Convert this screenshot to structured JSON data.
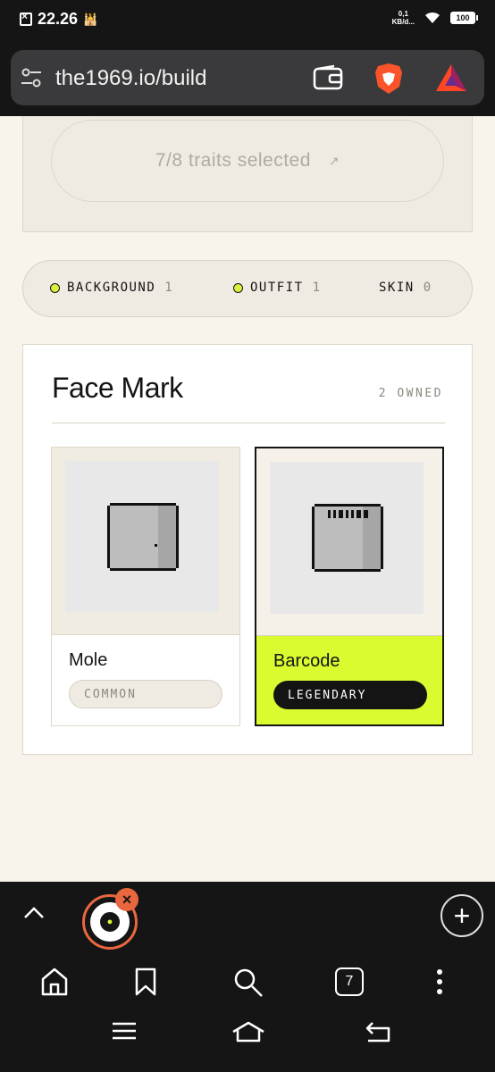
{
  "status": {
    "time": "22.26",
    "net_speed_value": "0,1",
    "net_speed_unit": "KB/d...",
    "battery": "100"
  },
  "browser": {
    "url": "the1969.io/build",
    "tab_count": "7"
  },
  "builder": {
    "traits_selected": "7/8 traits selected",
    "arrow": "↗"
  },
  "filters": [
    {
      "label": "BACKGROUND",
      "count": "1"
    },
    {
      "label": "OUTFIT",
      "count": "1"
    },
    {
      "label": "SKIN",
      "count": "0"
    }
  ],
  "category": {
    "title": "Face Mark",
    "owned": "2 OWNED",
    "traits": [
      {
        "name": "Mole",
        "rarity": "COMMON",
        "selected": false
      },
      {
        "name": "Barcode",
        "rarity": "LEGENDARY",
        "selected": true
      }
    ]
  },
  "colors": {
    "accent_lime": "#d9fb2f",
    "page_bg": "#f8f4ec",
    "chrome_dark": "#151515",
    "tab_ring": "#e8673f"
  }
}
